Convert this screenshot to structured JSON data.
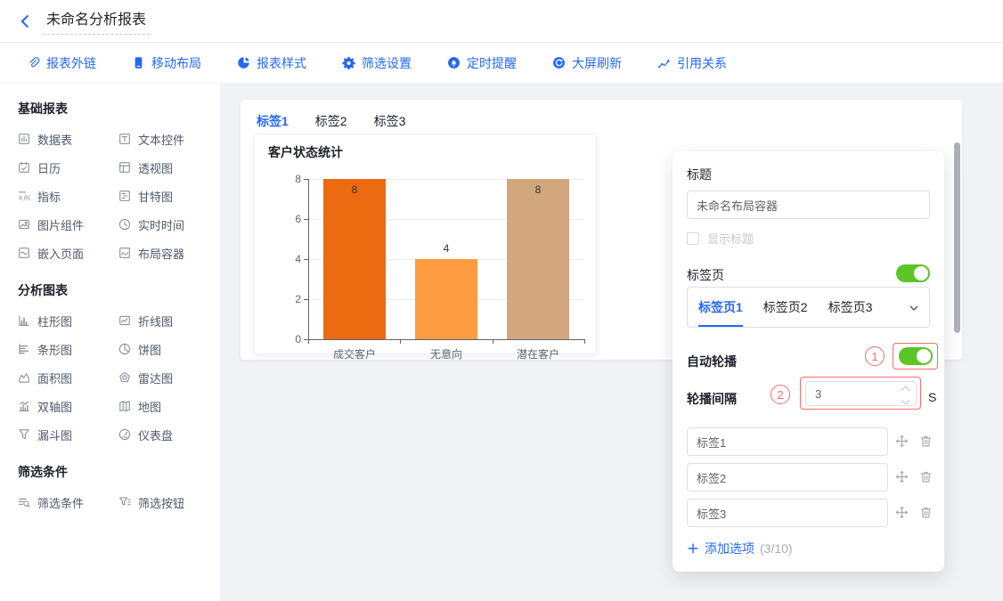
{
  "header": {
    "title": "未命名分析报表",
    "back_icon": "chevron-left-icon"
  },
  "toolbar": {
    "items": [
      {
        "id": "report-external-link",
        "icon": "link-icon",
        "label": "报表外链"
      },
      {
        "id": "mobile-layout",
        "icon": "mobile-icon",
        "label": "移动布局"
      },
      {
        "id": "report-style",
        "icon": "pie-icon",
        "label": "报表样式"
      },
      {
        "id": "filter-settings",
        "icon": "gear-icon",
        "label": "筛选设置"
      },
      {
        "id": "scheduled-reminder",
        "icon": "bell-icon",
        "label": "定时提醒"
      },
      {
        "id": "screen-refresh",
        "icon": "refresh-icon",
        "label": "大屏刷新"
      },
      {
        "id": "reference-relation",
        "icon": "relation-icon",
        "label": "引用关系"
      }
    ]
  },
  "sidebar": {
    "sections": [
      {
        "title": "基础报表",
        "items": [
          {
            "id": "data-table",
            "icon": "datatable-icon",
            "label": "数据表"
          },
          {
            "id": "text-widget",
            "icon": "text-icon",
            "label": "文本控件"
          },
          {
            "id": "calendar",
            "icon": "calendar-icon",
            "label": "日历"
          },
          {
            "id": "pivot",
            "icon": "pivot-icon",
            "label": "透视图"
          },
          {
            "id": "metric",
            "icon": "metric-icon",
            "label": "指标"
          },
          {
            "id": "gantt",
            "icon": "gantt-icon",
            "label": "甘特图"
          },
          {
            "id": "image-widget",
            "icon": "image-icon",
            "label": "图片组件"
          },
          {
            "id": "realtime-time",
            "icon": "clock-icon",
            "label": "实时时间"
          },
          {
            "id": "embed-page",
            "icon": "embed-icon",
            "label": "嵌入页面"
          },
          {
            "id": "layout-container",
            "icon": "container-icon",
            "label": "布局容器"
          }
        ]
      },
      {
        "title": "分析图表",
        "items": [
          {
            "id": "column-chart",
            "icon": "column-chart-icon",
            "label": "柱形图"
          },
          {
            "id": "line-chart",
            "icon": "line-chart-icon",
            "label": "折线图"
          },
          {
            "id": "bar-chart",
            "icon": "bar-chart-icon",
            "label": "条形图"
          },
          {
            "id": "pie-chart",
            "icon": "pie-chart-icon",
            "label": "饼图"
          },
          {
            "id": "area-chart",
            "icon": "area-chart-icon",
            "label": "面积图"
          },
          {
            "id": "radar-chart",
            "icon": "radar-icon",
            "label": "雷达图"
          },
          {
            "id": "dual-axis-chart",
            "icon": "dual-axis-icon",
            "label": "双轴图"
          },
          {
            "id": "map-chart",
            "icon": "map-icon",
            "label": "地图"
          },
          {
            "id": "funnel-chart",
            "icon": "funnel-icon",
            "label": "漏斗图"
          },
          {
            "id": "gauge-chart",
            "icon": "gauge-icon",
            "label": "仪表盘"
          }
        ]
      },
      {
        "title": "筛选条件",
        "items": [
          {
            "id": "filter-condition",
            "icon": "filter-condition-icon",
            "label": "筛选条件"
          },
          {
            "id": "filter-button",
            "icon": "filter-button-icon",
            "label": "筛选按钮"
          }
        ]
      }
    ]
  },
  "canvas": {
    "tabs": [
      {
        "label": "标签1",
        "active": true
      },
      {
        "label": "标签2",
        "active": false
      },
      {
        "label": "标签3",
        "active": false
      }
    ],
    "chart_title": "客户状态统计"
  },
  "chart_data": {
    "type": "bar",
    "title": "客户状态统计",
    "categories": [
      "成交客户",
      "无意向",
      "潜在客户"
    ],
    "values": [
      8,
      4,
      8
    ],
    "value_labels": [
      "8",
      "4",
      "8"
    ],
    "bar_colors": [
      "#EC6A10",
      "#FD9C40",
      "#D2A77D"
    ],
    "ylim": [
      0,
      8
    ],
    "yticks": [
      0,
      2,
      4,
      6,
      8
    ],
    "xlabel": "",
    "ylabel": "",
    "grid": true,
    "legend": null
  },
  "settings_panel": {
    "title_label": "标题",
    "title_value": "未命名布局容器",
    "show_title_label": "显示标题",
    "show_title_checked": false,
    "tab_page_label": "标签页",
    "tab_page_enabled": true,
    "tab_pages": [
      {
        "label": "标签页1",
        "active": true
      },
      {
        "label": "标签页2",
        "active": false
      },
      {
        "label": "标签页3",
        "active": false
      }
    ],
    "auto_carousel_label": "自动轮播",
    "auto_carousel_enabled": true,
    "annotation_1": "1",
    "annotation_2": "2",
    "carousel_interval_label": "轮播间隔",
    "carousel_interval_value": "3",
    "carousel_interval_unit": "S",
    "options": [
      "标签1",
      "标签2",
      "标签3"
    ],
    "add_option_label": "添加选项",
    "add_option_count": "(3/10)"
  },
  "colors": {
    "accent": "#2468F2",
    "toggle_on": "#5BC427",
    "annotation_red": "#F56C6C",
    "bar_1": "#EC6A10",
    "bar_2": "#FD9C40",
    "bar_3": "#D2A77D",
    "canvas_background": "#F1F2F6"
  }
}
